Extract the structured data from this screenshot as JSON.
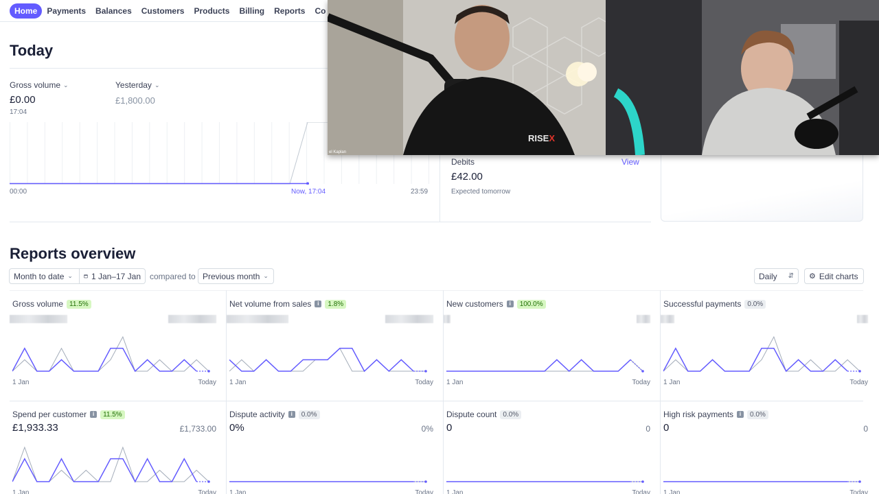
{
  "nav": {
    "items": [
      "Home",
      "Payments",
      "Balances",
      "Customers",
      "Products",
      "Billing",
      "Reports",
      "Co"
    ]
  },
  "today": {
    "title": "Today",
    "gross_label": "Gross volume",
    "gross_value": "£0.00",
    "gross_time": "17:04",
    "yesterday_label": "Yesterday",
    "yesterday_value": "£1,800.00",
    "axis_start": "00:00",
    "axis_now": "Now, 17:04",
    "axis_end": "23:59",
    "debits": {
      "title": "Debits",
      "view": "View",
      "value": "£42.00",
      "sub": "Expected tomorrow"
    }
  },
  "video_overlay": {
    "shirt_text": "RISE",
    "shirt_accent": "X",
    "name_tag": "el Kaplan"
  },
  "reports": {
    "title": "Reports overview",
    "range_select": "Month to date",
    "date_range": "1 Jan–17 Jan",
    "compared_to": "compared to",
    "compare_select": "Previous month",
    "interval": "Daily",
    "edit_charts": "Edit charts",
    "start_label": "1 Jan",
    "end_label": "Today",
    "cards": [
      {
        "title": "Gross volume",
        "info": false,
        "badge": "11.5%",
        "badge_type": "green"
      },
      {
        "title": "Net volume from sales",
        "info": true,
        "badge": "1.8%",
        "badge_type": "green"
      },
      {
        "title": "New customers",
        "info": true,
        "badge": "100.0%",
        "badge_type": "green"
      },
      {
        "title": "Successful payments",
        "info": false,
        "badge": "0.0%",
        "badge_type": "grey"
      },
      {
        "title": "Spend per customer",
        "info": true,
        "badge": "11.5%",
        "badge_type": "green",
        "value": "£1,933.33",
        "compare": "£1,733.00"
      },
      {
        "title": "Dispute activity",
        "info": true,
        "badge": "0.0%",
        "badge_type": "grey",
        "value": "0%",
        "compare": "0%"
      },
      {
        "title": "Dispute count",
        "info": false,
        "badge": "0.0%",
        "badge_type": "grey",
        "value": "0",
        "compare": "0"
      },
      {
        "title": "High risk payments",
        "info": true,
        "badge": "0.0%",
        "badge_type": "grey",
        "value": "0",
        "compare": "0"
      }
    ]
  },
  "colors": {
    "accent": "#635bff",
    "compare_line": "#a3acb9",
    "text": "#1a1f36"
  },
  "sparklines": {
    "current": [
      [
        0,
        2,
        0,
        0,
        1,
        0,
        0,
        0,
        2,
        2,
        0,
        1,
        0,
        0,
        1,
        0,
        0
      ],
      [
        1,
        0,
        0,
        1,
        0,
        0,
        1,
        1,
        1,
        2,
        2,
        0,
        1,
        0,
        1,
        0,
        0
      ],
      [
        0,
        0,
        0,
        0,
        0,
        0,
        0,
        0,
        0,
        1,
        0,
        1,
        0,
        0,
        0,
        1,
        0
      ],
      [
        0,
        2,
        0,
        0,
        1,
        0,
        0,
        0,
        2,
        2,
        0,
        1,
        0,
        0,
        1,
        0,
        0
      ],
      [
        0,
        2,
        0,
        0,
        2,
        0,
        0,
        0,
        2,
        2,
        0,
        2,
        0,
        0,
        2,
        0,
        0
      ],
      [
        0,
        0,
        0,
        0,
        0,
        0,
        0,
        0,
        0,
        0,
        0,
        0,
        0,
        0,
        0,
        0,
        0
      ],
      [
        0,
        0,
        0,
        0,
        0,
        0,
        0,
        0,
        0,
        0,
        0,
        0,
        0,
        0,
        0,
        0,
        0
      ],
      [
        0,
        0,
        0,
        0,
        0,
        0,
        0,
        0,
        0,
        0,
        0,
        0,
        0,
        0,
        0,
        0,
        0
      ]
    ],
    "compare": [
      [
        0,
        1,
        0,
        0,
        2,
        0,
        0,
        0,
        1,
        3,
        0,
        0,
        1,
        0,
        0,
        1,
        0
      ],
      [
        0,
        1,
        0,
        1,
        0,
        0,
        0,
        1,
        1,
        2,
        0,
        0,
        1,
        0,
        0,
        0,
        0
      ],
      [
        0,
        0,
        0,
        0,
        0,
        0,
        0,
        0,
        0,
        0,
        0,
        0,
        0,
        0,
        0,
        1,
        0
      ],
      [
        0,
        1,
        0,
        0,
        1,
        0,
        0,
        0,
        1,
        3,
        0,
        0,
        1,
        0,
        0,
        1,
        0
      ],
      [
        0,
        3,
        0,
        0,
        1,
        0,
        1,
        0,
        0,
        3,
        0,
        0,
        1,
        0,
        0,
        1,
        0
      ],
      [
        0,
        0,
        0,
        0,
        0,
        0,
        0,
        0,
        0,
        0,
        0,
        0,
        0,
        0,
        0,
        0,
        0
      ],
      [
        0,
        0,
        0,
        0,
        0,
        0,
        0,
        0,
        0,
        0,
        0,
        0,
        0,
        0,
        0,
        0,
        0
      ],
      [
        0,
        0,
        0,
        0,
        0,
        0,
        0,
        0,
        0,
        0,
        0,
        0,
        0,
        0,
        0,
        0,
        0
      ]
    ]
  }
}
